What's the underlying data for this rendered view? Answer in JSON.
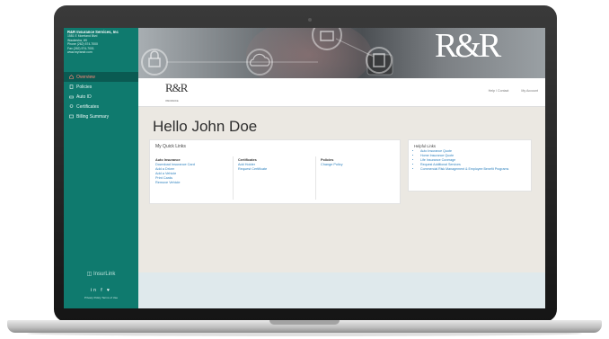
{
  "sidebar": {
    "company_name": "R&R Insurance Services, Inc",
    "address_line1": "1581 E Moreland Blvd",
    "address_line2": "Waukesha, WI",
    "phone": "Phone (262) 574-7000",
    "fax": "Fax (262) 574-7001",
    "website": "www.myrandr.com",
    "nav": [
      {
        "label": "Overview",
        "icon": "home-icon",
        "active": true
      },
      {
        "label": "Policies",
        "icon": "policy-icon"
      },
      {
        "label": "Auto ID",
        "icon": "car-icon"
      },
      {
        "label": "Certificates",
        "icon": "certificate-icon"
      },
      {
        "label": "Billing Summary",
        "icon": "billing-icon"
      }
    ],
    "brand": "InsurLink",
    "social_icons": "in f ♥",
    "footer_links": "Privacy Policy  Terms of Use"
  },
  "banner": {
    "logo": "R&R"
  },
  "topbar": {
    "logo": "R&R",
    "logo_sub": "INSURANCE",
    "link_help": "Help / Contact",
    "link_account": "My Account"
  },
  "main": {
    "greeting": "Hello John Doe",
    "quick_links": {
      "title": "My Quick Links",
      "columns": [
        {
          "heading": "Auto Insurance",
          "links": [
            "Download Insurance Card",
            "Add a Driver",
            "Add a Vehicle",
            "Print Cards",
            "Remove Vehicle"
          ]
        },
        {
          "heading": "Certificates",
          "links": [
            "Add Holder",
            "Request Certificate"
          ]
        },
        {
          "heading": "Policies",
          "links": [
            "Change Policy"
          ]
        }
      ]
    },
    "helpful": {
      "title": "Helpful Links",
      "items": [
        "Auto Insurance Quote",
        "Home Insurance Quote",
        "Life Insurance Coverage",
        "Request Additional Services",
        "Commercial Risk Management & Employee Benefit Programs"
      ]
    }
  },
  "colors": {
    "sidebar": "#0f7a6e",
    "active_nav": "#0a5a52",
    "link": "#2a7fbd",
    "content_bg": "#ebe8e2"
  }
}
